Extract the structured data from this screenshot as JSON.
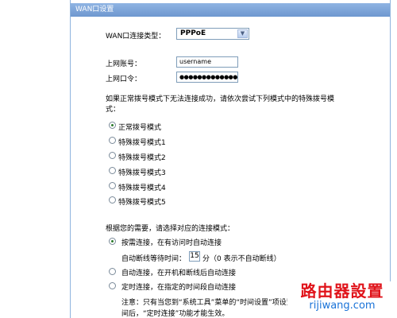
{
  "header": {
    "title": "WAN口设置"
  },
  "connection_type": {
    "label": "WAN口连接类型：",
    "selected": "PPPoE"
  },
  "account": {
    "username_label": "上网账号：",
    "username_value": "username",
    "password_label": "上网口令：",
    "password_value": "●●●●●●●●●●●●●"
  },
  "special_dial": {
    "prompt": "如果正常拨号模式下无法连接成功，请依次尝试下列模式中的特殊拨号模",
    "prompt_line2": "式：",
    "options": [
      "正常拨号模式",
      "特殊拨号模式1",
      "特殊拨号模式2",
      "特殊拨号模式3",
      "特殊拨号模式4",
      "特殊拨号模式5"
    ],
    "selected_index": 0
  },
  "connect_mode": {
    "prompt": "根据您的需要，请选择对应的连接模式：",
    "on_demand": "按需连接，在有访问时自动连接",
    "idle_label": "自动断线等待时间：",
    "idle_value": "15",
    "idle_unit": "分（0 表示不自动断线）",
    "auto": "自动连接，在开机和断线后自动连接",
    "timed": "定时连接，在指定的时间段自动连接",
    "note_line1": "注意：只有当您到“系统工具”菜单的“时间设置”项设置",
    "note_line2": "间后，“定时连接”功能才能生效。",
    "selected_index": 0
  },
  "watermark": {
    "text": "路由器設置",
    "url": "rijiwang.com"
  },
  "colors": {
    "header_bg": "#7aa0d6",
    "border": "#8fb4de",
    "watermark_red": "#e0131a",
    "watermark_blue": "#1a73d8"
  }
}
